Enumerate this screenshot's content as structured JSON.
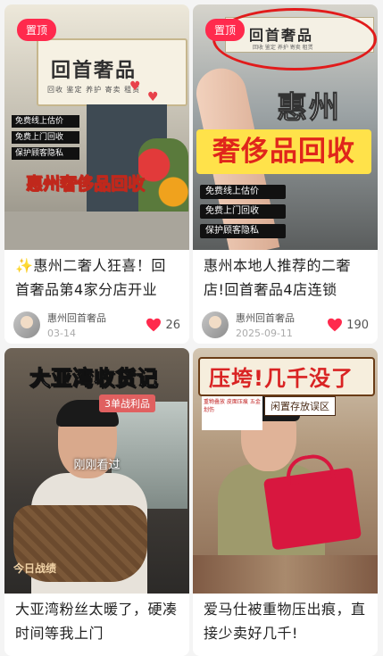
{
  "pin_label": "置顶",
  "cards": [
    {
      "title": "✨惠州二奢人狂喜！回首奢品第4家分店开业",
      "author": "惠州回首奢品",
      "date": "03-14",
      "likes": "26",
      "cover": {
        "sign_title": "回首奢品",
        "sign_sub": "回收 鉴定 养护 寄卖 租赁",
        "bullets": [
          "免费线上估价",
          "免费上门回收",
          "保护顾客隐私"
        ],
        "headline": "惠州奢侈品回收"
      }
    },
    {
      "title": "惠州本地人推荐的二奢店!回首奢品4店连锁",
      "author": "惠州回首奢品",
      "date": "2025-09-11",
      "likes": "190",
      "cover": {
        "sign_title": "回首奢品",
        "sign_sub": "回收 鉴定 养护 寄卖 租赁",
        "headline_1": "惠州",
        "headline_2": "奢侈品回收",
        "bullets": [
          "免费线上估价",
          "免费上门回收",
          "保护顾客隐私"
        ]
      }
    },
    {
      "title": "大亚湾粉丝太暖了，硬凑时间等我上门",
      "cover": {
        "headline": "大亚湾收货记",
        "tag": "3单战利品",
        "overlay": "刚刚看过",
        "corner": "今日战绩"
      }
    },
    {
      "title": "爱马仕被重物压出痕，直接少卖好几千!",
      "cover": {
        "headline": "压垮!几千没了",
        "sub": "闲置存放误区",
        "note": "重物叠放 皮面压痕 五金划伤"
      }
    }
  ],
  "colors": {
    "accent": "#ff2a4d",
    "background": "#f4f4f4"
  }
}
